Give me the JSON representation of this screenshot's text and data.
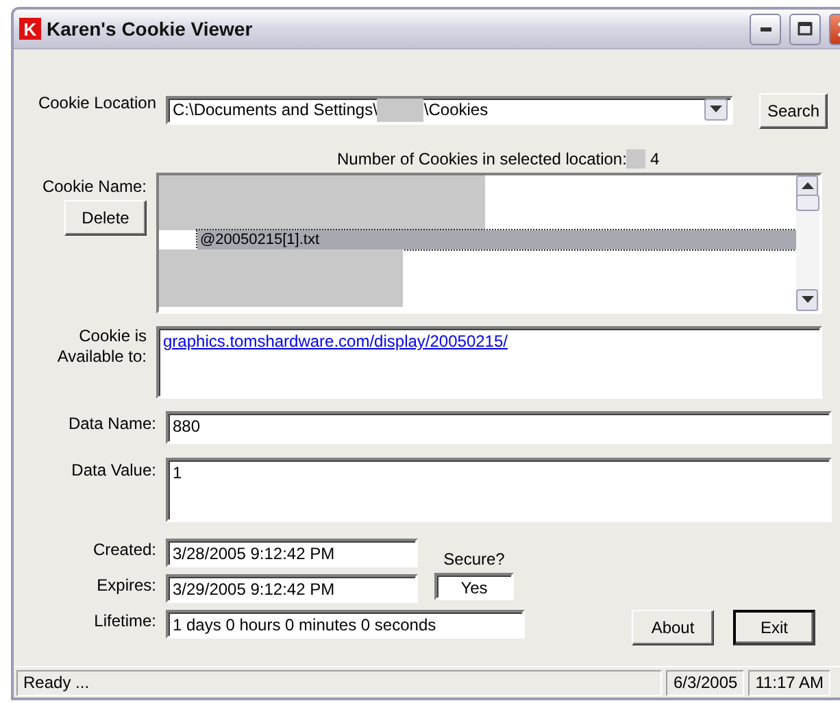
{
  "window": {
    "title": "Karen's Cookie Viewer",
    "app_icon": "K"
  },
  "location": {
    "label": "Cookie Location",
    "path_parts": [
      "C:\\Documents and Settings\\",
      "\\Cookies"
    ],
    "search_button": "Search"
  },
  "count": {
    "label": "Number of Cookies in selected location:",
    "value": "4"
  },
  "cookie_name": {
    "label": "Cookie Name:",
    "delete_button": "Delete",
    "items": [
      {
        "kind": "redacted",
        "selected": false
      },
      {
        "kind": "text",
        "text": "@20050215[1].txt",
        "selected": true
      },
      {
        "kind": "redacted",
        "selected": false
      }
    ]
  },
  "available": {
    "label_lines": [
      "Cookie is",
      "Available to:"
    ],
    "link": "graphics.tomshardware.com/display/20050215/"
  },
  "data_name": {
    "label": "Data Name:",
    "value": "880"
  },
  "data_value": {
    "label": "Data Value:",
    "value": "1"
  },
  "created": {
    "label": "Created:",
    "value": "3/28/2005 9:12:42 PM"
  },
  "expires": {
    "label": "Expires:",
    "value": "3/29/2005 9:12:42 PM"
  },
  "secure": {
    "label": "Secure?",
    "value": "Yes"
  },
  "lifetime": {
    "label": "Lifetime:",
    "value": "1 days 0 hours 0 minutes 0 seconds"
  },
  "buttons": [
    {
      "label": "About",
      "default": false
    },
    {
      "label": "Exit",
      "default": true
    }
  ],
  "status_bar": {
    "message": "Ready ...",
    "date": "6/3/2005",
    "time": "11:17 AM"
  }
}
